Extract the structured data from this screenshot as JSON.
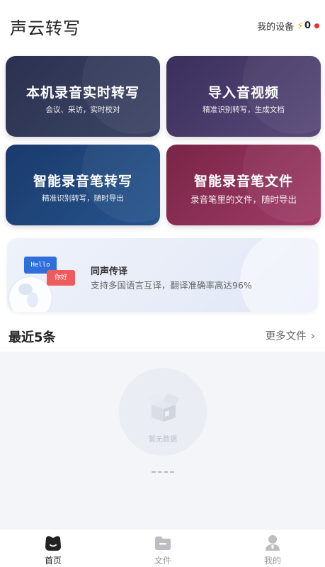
{
  "header": {
    "title": "声云转写",
    "device_label": "我的设备",
    "device_count": "0"
  },
  "cards": [
    {
      "title": "本机录音实时转写",
      "subtitle": "会议、采访，实时校对"
    },
    {
      "title": "导入音视频",
      "subtitle": "精准识别转写，生成文档"
    },
    {
      "title": "智能录音笔转写",
      "subtitle": "精准识别转写，随时导出"
    },
    {
      "title": "智能录音笔文件",
      "subtitle": "录音笔里的文件，随时导出"
    }
  ],
  "banner": {
    "hello_text": "Hello",
    "nihao_text": "你好",
    "title": "同声传译",
    "subtitle": "支持多国语言互译，翻译准确率高达96%"
  },
  "recent": {
    "title": "最近5条",
    "more_label": "更多文件",
    "empty_text": "暂无数据"
  },
  "tabbar": {
    "items": [
      {
        "label": "首页"
      },
      {
        "label": "文件"
      },
      {
        "label": "我的"
      }
    ]
  },
  "colors": {
    "accent_red": "#e5332a",
    "bolt": "#f2a300"
  }
}
